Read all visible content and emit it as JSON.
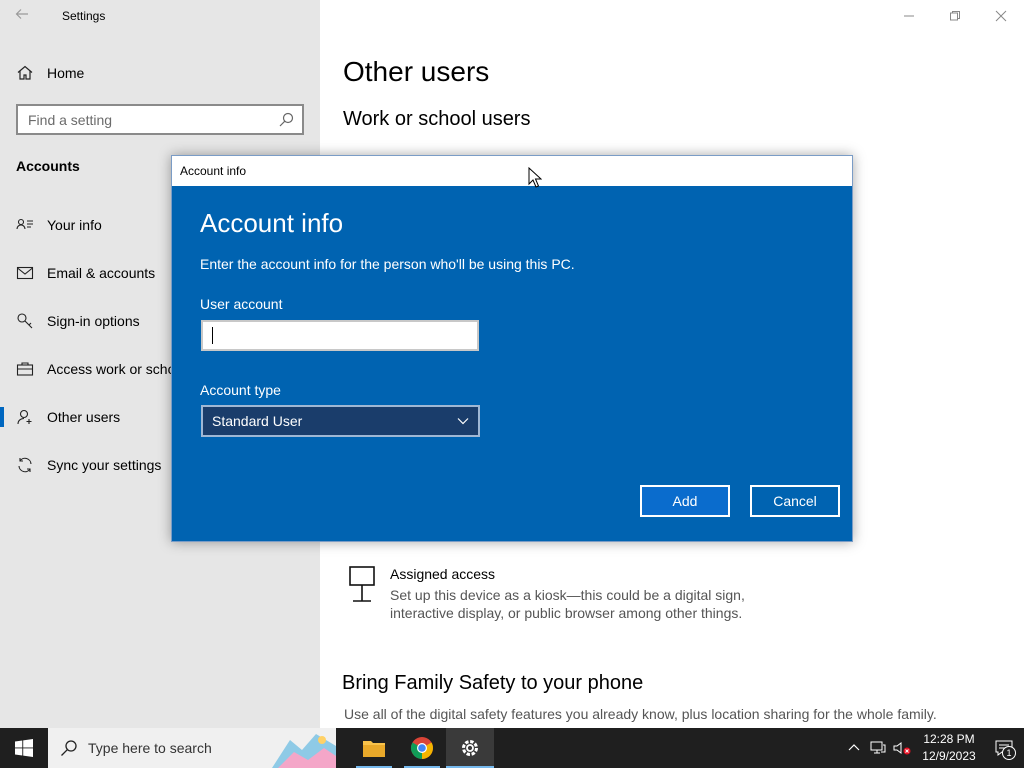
{
  "window": {
    "title": "Settings"
  },
  "sidebar": {
    "home_label": "Home",
    "search_placeholder": "Find a setting",
    "section_label": "Accounts",
    "items": [
      {
        "label": "Your info",
        "icon": "person-card-icon"
      },
      {
        "label": "Email & accounts",
        "icon": "mail-icon"
      },
      {
        "label": "Sign-in options",
        "icon": "key-icon"
      },
      {
        "label": "Access work or school",
        "icon": "briefcase-icon"
      },
      {
        "label": "Other users",
        "icon": "person-add-icon",
        "active": true
      },
      {
        "label": "Sync your settings",
        "icon": "sync-icon"
      }
    ]
  },
  "main": {
    "title": "Other users",
    "subtitle": "Work or school users",
    "assigned_access": {
      "title": "Assigned access",
      "description": "Set up this device as a kiosk—this could be a digital sign, interactive display, or public browser among other things."
    },
    "family": {
      "title": "Bring Family Safety to your phone",
      "description": "Use all of the digital safety features you already know, plus location sharing for the whole family."
    }
  },
  "dialog": {
    "titlebar": "Account info",
    "heading": "Account info",
    "description": "Enter the account info for the person who'll be using this PC.",
    "user_account_label": "User account",
    "user_account_value": "",
    "account_type_label": "Account type",
    "account_type_value": "Standard User",
    "add_label": "Add",
    "cancel_label": "Cancel",
    "accent_color": "#0063b1"
  },
  "taskbar": {
    "search_placeholder": "Type here to search",
    "clock_time": "12:28 PM",
    "clock_date": "12/9/2023",
    "notification_count": "1"
  }
}
